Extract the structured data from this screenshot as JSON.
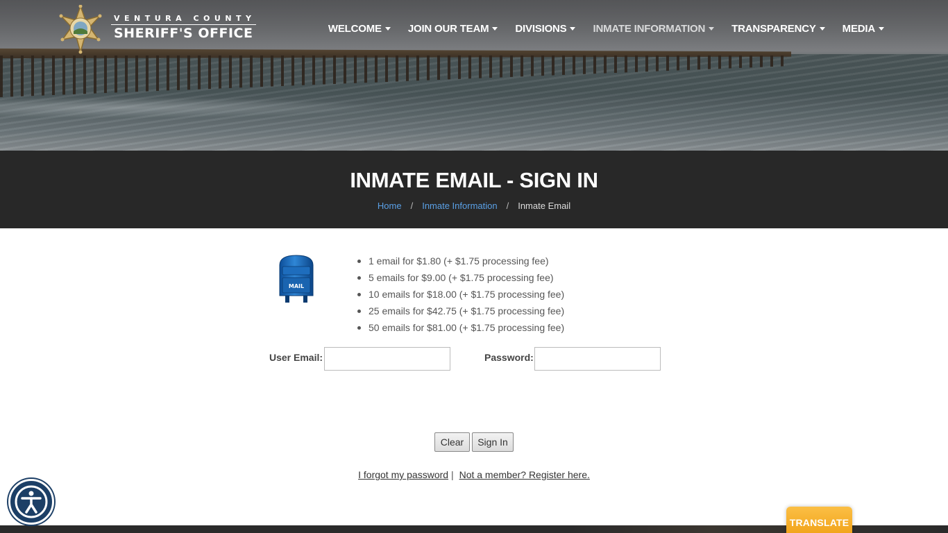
{
  "header": {
    "logo_county": "VENTURA COUNTY",
    "logo_office": "SHERIFF'S OFFICE",
    "nav": [
      {
        "label": "WELCOME"
      },
      {
        "label": "JOIN OUR TEAM"
      },
      {
        "label": "DIVISIONS"
      },
      {
        "label": "INMATE INFORMATION"
      },
      {
        "label": "TRANSPARENCY"
      },
      {
        "label": "MEDIA"
      }
    ]
  },
  "title_bar": {
    "title": "INMATE EMAIL - SIGN IN",
    "breadcrumb": [
      {
        "label": "Home"
      },
      {
        "label": "Inmate Information"
      },
      {
        "label": "Inmate Email"
      }
    ],
    "separator": "/"
  },
  "content": {
    "mailbox_label": "MAIL",
    "prices": [
      {
        "text": "1 email for $1.80 (+ $1.75 processing fee)"
      },
      {
        "text": "5 emails for $9.00 (+ $1.75 processing fee)"
      },
      {
        "text": "10 emails for $18.00 (+ $1.75 processing fee)"
      },
      {
        "text": "25 emails for $42.75 (+ $1.75 processing fee)"
      },
      {
        "text": "50 emails for $81.00 (+ $1.75 processing fee)"
      }
    ],
    "user_email_label": "User Email:",
    "user_email_value": "",
    "password_label": "Password:",
    "password_value": "",
    "clear_label": "Clear",
    "signin_label": "Sign In",
    "forgot_label": "I forgot my password",
    "links_sep": "|",
    "register_label": "Not a member? Register here."
  },
  "widgets": {
    "translate_label": "TRANSLATE",
    "accessibility_icon": "accessibility-icon"
  },
  "colors": {
    "title_bar_bg": "#282828",
    "link_blue": "#5aa0e6",
    "translate_orange": "#f2a51c",
    "access_navy": "#1c3f66"
  }
}
